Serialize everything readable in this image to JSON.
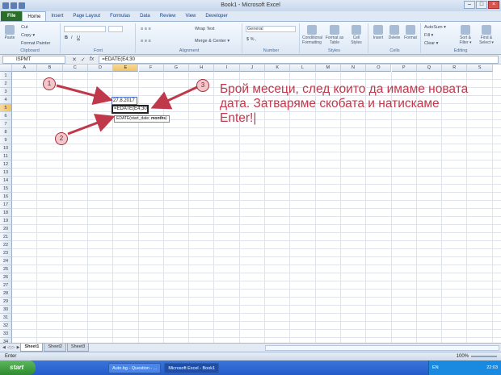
{
  "window": {
    "title": "Book1 - Microsoft Excel"
  },
  "ribbon": {
    "tabs": [
      "File",
      "Home",
      "Insert",
      "Page Layout",
      "Formulas",
      "Data",
      "Review",
      "View",
      "Developer"
    ],
    "clipboard": {
      "paste": "Paste",
      "cut": "Cut",
      "copy": "Copy ▾",
      "format_painter": "Format Painter",
      "label": "Clipboard"
    },
    "font": {
      "label": "Font"
    },
    "alignment": {
      "wrap": "Wrap Text",
      "merge": "Merge & Center ▾",
      "label": "Alignment"
    },
    "number": {
      "format": "General",
      "label": "Number"
    },
    "styles": {
      "conditional": "Conditional Formatting",
      "table": "Format as Table",
      "cell_styles": "Cell Styles",
      "label": "Styles"
    },
    "cells": {
      "insert": "Insert",
      "delete": "Delete",
      "format": "Format",
      "label": "Cells"
    },
    "editing": {
      "autosum": "AutoSum ▾",
      "fill": "Fill ▾",
      "clear": "Clear ▾",
      "sort": "Sort & Filter ▾",
      "find": "Find & Select ▾",
      "label": "Editing"
    }
  },
  "formula_bar": {
    "name_box": "ISPMT",
    "formula": "=EDATE(E4;30"
  },
  "grid": {
    "columns": [
      "A",
      "B",
      "C",
      "D",
      "E",
      "F",
      "G",
      "H",
      "I",
      "J",
      "K",
      "L",
      "M",
      "N",
      "O",
      "P",
      "Q",
      "R",
      "S"
    ],
    "rows": [
      "1",
      "2",
      "3",
      "4",
      "5",
      "6",
      "7",
      "8",
      "9",
      "10",
      "11",
      "12",
      "13",
      "14",
      "15",
      "16",
      "17",
      "18",
      "19",
      "20",
      "21",
      "22",
      "23",
      "24",
      "25",
      "26",
      "27",
      "28",
      "29",
      "30",
      "31",
      "32",
      "33",
      "34"
    ],
    "cell_e4": "27.8.2017",
    "cell_e5": "=EDATE(E4;30",
    "tooltip_start": "EDATE(start_date; ",
    "tooltip_bold": "months"
  },
  "annotation": {
    "text": "Брой месеци, след които да имаме новата дата. Затваряме скобата и натискаме  Enter!|",
    "badges": [
      "1",
      "2",
      "3"
    ],
    "color": "#c0394b"
  },
  "sheets": [
    "Sheet1",
    "Sheet2",
    "Sheet3"
  ],
  "status": {
    "mode": "Enter",
    "zoom": "100%"
  },
  "taskbar": {
    "start": "start",
    "items": [
      "Auto.bg - Question - ...",
      "Microsoft Excel - Book1"
    ],
    "lang": "EN",
    "clock": "22:03"
  }
}
